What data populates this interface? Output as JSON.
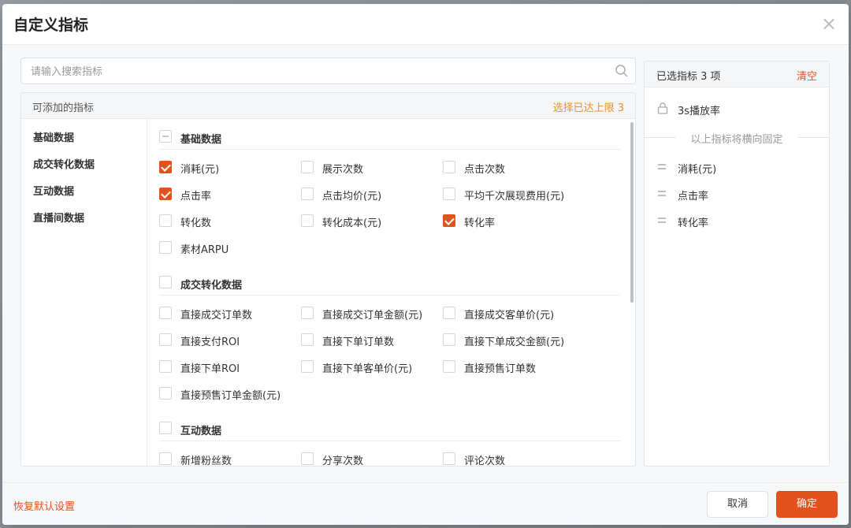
{
  "dialog": {
    "title": "自定义指标",
    "close_icon": "close-icon"
  },
  "search": {
    "placeholder": "请输入搜索指标",
    "value": ""
  },
  "left_panel": {
    "title": "可添加的指标",
    "limit_text": "选择已达上限 3",
    "categories": [
      "基础数据",
      "成交转化数据",
      "互动数据",
      "直播间数据"
    ],
    "sections": [
      {
        "title": "基础数据",
        "state": "indeterminate",
        "options": [
          {
            "label": "消耗(元)",
            "checked": true
          },
          {
            "label": "展示次数",
            "checked": false
          },
          {
            "label": "点击次数",
            "checked": false
          },
          {
            "label": "点击率",
            "checked": true
          },
          {
            "label": "点击均价(元)",
            "checked": false
          },
          {
            "label": "平均千次展现费用(元)",
            "checked": false
          },
          {
            "label": "转化数",
            "checked": false
          },
          {
            "label": "转化成本(元)",
            "checked": false
          },
          {
            "label": "转化率",
            "checked": true
          },
          {
            "label": "素材ARPU",
            "checked": false
          }
        ]
      },
      {
        "title": "成交转化数据",
        "state": "unchecked",
        "options": [
          {
            "label": "直接成交订单数",
            "checked": false
          },
          {
            "label": "直接成交订单金额(元)",
            "checked": false
          },
          {
            "label": "直接成交客单价(元)",
            "checked": false
          },
          {
            "label": "直接支付ROI",
            "checked": false
          },
          {
            "label": "直接下单订单数",
            "checked": false
          },
          {
            "label": "直接下单成交金额(元)",
            "checked": false
          },
          {
            "label": "直接下单ROI",
            "checked": false
          },
          {
            "label": "直接下单客单价(元)",
            "checked": false
          },
          {
            "label": "直接预售订单数",
            "checked": false
          },
          {
            "label": "直接预售订单金额(元)",
            "checked": false
          }
        ]
      },
      {
        "title": "互动数据",
        "state": "unchecked",
        "options": [
          {
            "label": "新增粉丝数",
            "checked": false
          },
          {
            "label": "分享次数",
            "checked": false
          },
          {
            "label": "评论次数",
            "checked": false
          }
        ]
      }
    ]
  },
  "right_panel": {
    "title": "已选指标 3 项",
    "clear_label": "清空",
    "fixed_item": "3s播放率",
    "fixed_note": "以上指标将横向固定",
    "selected": [
      "消耗(元)",
      "点击率",
      "转化率"
    ]
  },
  "footer": {
    "reset_label": "恢复默认设置",
    "cancel_label": "取消",
    "ok_label": "确定"
  },
  "colors": {
    "accent": "#e2521c",
    "limit": "#f0901e"
  }
}
